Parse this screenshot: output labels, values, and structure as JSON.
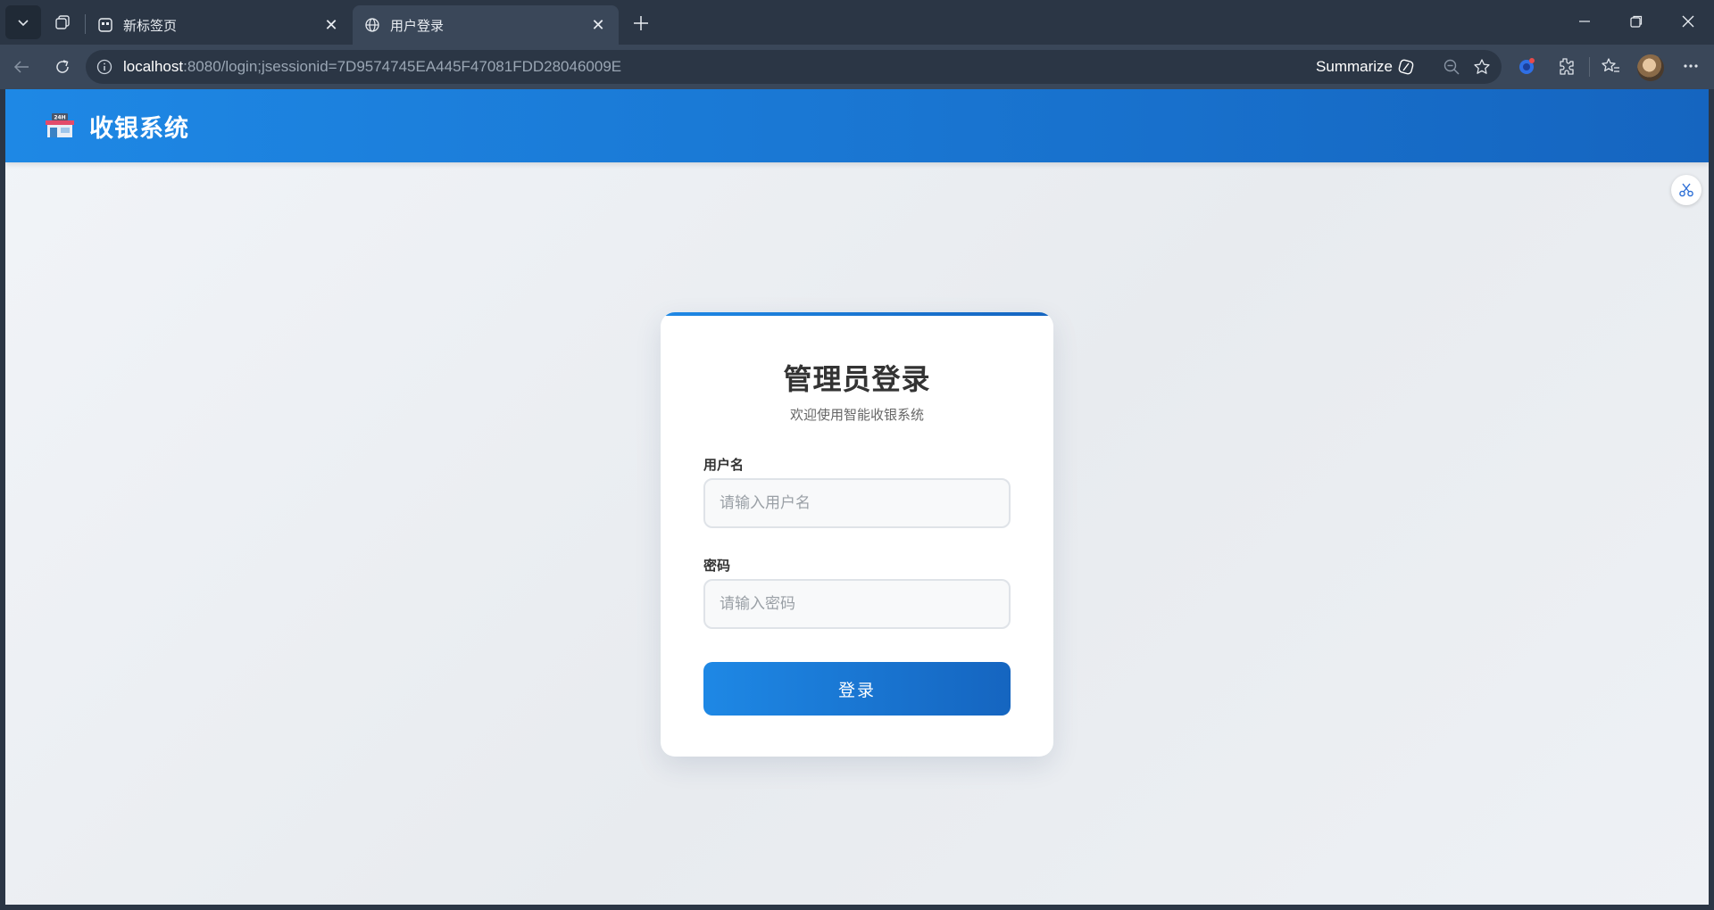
{
  "browser": {
    "tabs": [
      {
        "title": "新标签页",
        "icon": "new-tab-page-icon"
      },
      {
        "title": "用户登录",
        "icon": "globe-icon"
      }
    ],
    "url": {
      "host": "localhost",
      "rest": ":8080/login;jsessionid=7D9574745EA445F47081FDD28046009E"
    },
    "summarize_label": "Summarize"
  },
  "app": {
    "title": "收银系统",
    "brand_color": "#1e88e5",
    "brand_color_dark": "#1565c0"
  },
  "login": {
    "title": "管理员登录",
    "subtitle": "欢迎使用智能收银系统",
    "username_label": "用户名",
    "username_placeholder": "请输入用户名",
    "username_value": "",
    "password_label": "密码",
    "password_placeholder": "请输入密码",
    "password_value": "",
    "submit_label": "登录"
  }
}
